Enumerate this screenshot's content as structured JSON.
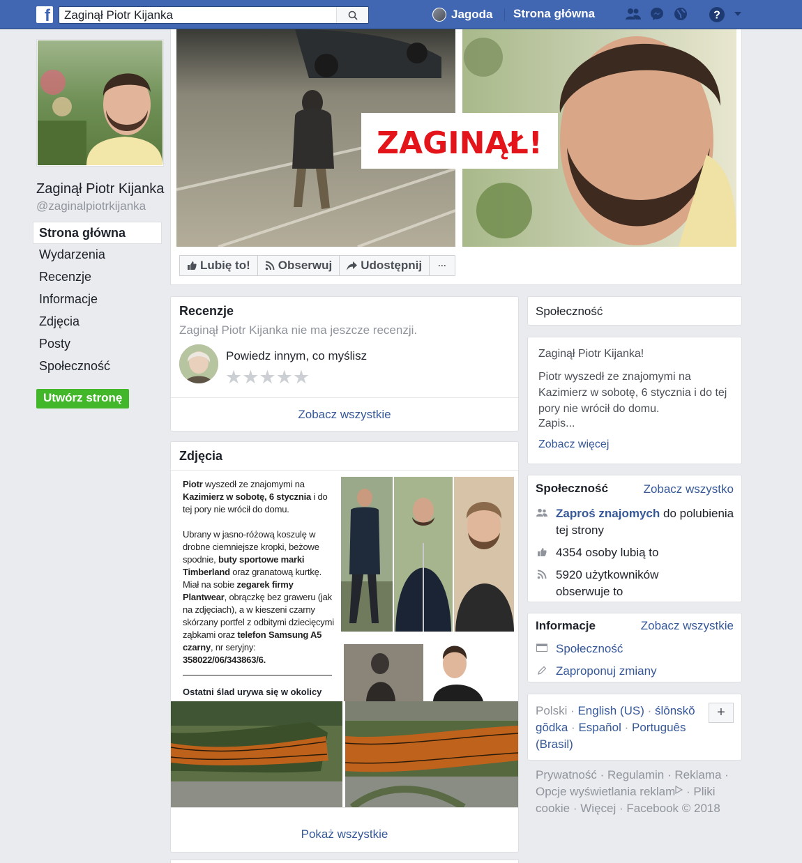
{
  "topbar": {
    "search_value": "Zaginął Piotr Kijanka",
    "user_name": "Jagoda",
    "home_label": "Strona główna",
    "brand_color": "#4267b2"
  },
  "page": {
    "name": "Zaginął Piotr Kijanka",
    "handle": "@zaginalpiotrkijanka",
    "nav": [
      "Strona główna",
      "Wydarzenia",
      "Recenzje",
      "Informacje",
      "Zdjęcia",
      "Posty",
      "Społeczność"
    ],
    "create_page": "Utwórz stronę"
  },
  "cover": {
    "banner_text": "ZAGINĄŁ!"
  },
  "actions": {
    "like": "Lubię to!",
    "follow": "Obserwuj",
    "share": "Udostępnij",
    "more": "···"
  },
  "reviews": {
    "title": "Recenzje",
    "none_text": "Zaginął Piotr Kijanka nie ma jeszcze recenzji.",
    "prompt": "Powiedz innym, co myślisz",
    "stars": "★★★★★",
    "see_all": "Zobacz wszystkie"
  },
  "photos": {
    "title": "Zdjęcia",
    "show_all": "Pokaż wszystkie",
    "poster_last": "Ostatni ślad urywa się w okolicy"
  },
  "right": {
    "community_label": "Społeczność",
    "about_title": "Zaginął Piotr Kijanka!",
    "about_text": "Piotr wyszedł ze znajomymi na Kazimierz w sobotę, 6 stycznia i do tej pory nie wrócił do domu.",
    "about_more": "Zapis...",
    "see_more": "Zobacz więcej",
    "comm_title": "Społeczność",
    "comm_see_all": "Zobacz wszystko",
    "invite_link": "Zaproś znajomych",
    "invite_rest": " do polubienia tej strony",
    "likes": "4354 osoby lubią to",
    "followers": "5920 użytkowników obserwuje to",
    "info_title": "Informacje",
    "info_see_all": "Zobacz wszystkie",
    "info_community": "Społeczność",
    "info_suggest": "Zaproponuj zmiany"
  },
  "languages": {
    "current": "Polski",
    "others": [
      "English (US)",
      "ślōnskŏ gŏdka",
      "Español",
      "Português (Brasil)"
    ],
    "plus": "+"
  },
  "footer": {
    "privacy": "Prywatność",
    "terms": "Regulamin",
    "ads": "Reklama",
    "ad_choices": "Opcje wyświetlania reklam",
    "cookies": "Pliki cookie",
    "more": "Więcej",
    "copyright": "Facebook © 2018"
  }
}
